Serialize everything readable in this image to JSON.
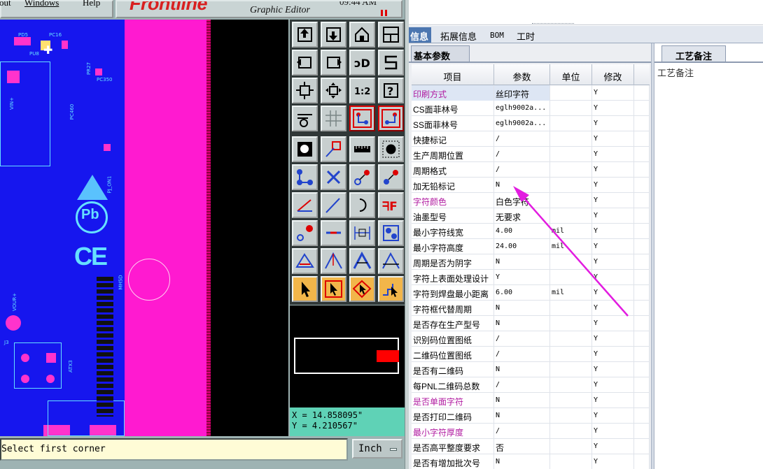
{
  "cad": {
    "menu": {
      "item_a": "out",
      "windows": "Windows",
      "help": "Help"
    },
    "logo": {
      "brand": "Frontline",
      "subtitle": "Graphic Editor",
      "time": "09:44 AM"
    },
    "board_labels": {
      "pc16": "PC16",
      "pu8": "PU8",
      "pd5": "PD5",
      "pr27": "PR27",
      "pc350": "PC350",
      "vin": "VIN+",
      "pc460": "PC460",
      "pj": "PJ_ON1",
      "mh": "MH5D",
      "vour": "VOUR+",
      "j3": "J3",
      "atx": "ATX3"
    },
    "coordinates": {
      "x": "X = 14.858095\"",
      "y": "Y = 4.210567\""
    },
    "prompt": "Select first corner",
    "units": "Inch",
    "tool_icons": [
      "move-up-icon",
      "move-down-icon",
      "home-icon",
      "window-icon",
      "align-left-icon",
      "align-right-icon",
      "undo-icon",
      "reshape-icon",
      "fit-icon",
      "zoom-icon",
      "ratio-icon",
      "help-icon",
      "settings-icon",
      "grid-icon",
      "layer-a-icon",
      "layer-b-icon",
      "pad-icon",
      "line-pad-icon",
      "measure-icon",
      "hole-icon",
      "net-icon",
      "cross-icon",
      "connect-icon",
      "route-icon",
      "draw-line-icon",
      "diag-line-icon",
      "arc-icon",
      "text-icon",
      "via-icon",
      "segment-icon",
      "dimension-icon",
      "component-icon",
      "triangle-a-icon",
      "triangle-b-icon",
      "triangle-c-icon",
      "triangle-d-icon",
      "select-icon",
      "select-box-icon",
      "select-net-icon",
      "select-path-icon"
    ],
    "ratio_label": "1:2"
  },
  "app": {
    "tabs": [
      "信息",
      "拓展信息",
      "BOM",
      "工时"
    ],
    "active_tab": "信息",
    "subtab": "基本参数",
    "columns": [
      "项目",
      "参数",
      "单位",
      "修改"
    ],
    "rows": [
      {
        "item": "印刷方式",
        "value": "丝印字符",
        "unit": "",
        "mod": "Y",
        "hl": true,
        "mono": false,
        "sel": true
      },
      {
        "item": "CS面菲林号",
        "value": "eglh9002a...",
        "unit": "",
        "mod": "Y",
        "hl": false,
        "mono": true
      },
      {
        "item": "SS面菲林号",
        "value": "eglh9002a...",
        "unit": "",
        "mod": "Y",
        "hl": false,
        "mono": true
      },
      {
        "item": "快捷标记",
        "value": "/",
        "unit": "",
        "mod": "Y",
        "hl": false,
        "mono": true
      },
      {
        "item": "生产周期位置",
        "value": "/",
        "unit": "",
        "mod": "Y",
        "hl": false,
        "mono": true
      },
      {
        "item": "周期格式",
        "value": "/",
        "unit": "",
        "mod": "Y",
        "hl": false,
        "mono": true
      },
      {
        "item": "加无铅标记",
        "value": "N",
        "unit": "",
        "mod": "Y",
        "hl": false,
        "mono": true
      },
      {
        "item": "字符颜色",
        "value": "白色字符",
        "unit": "",
        "mod": "Y",
        "hl": true,
        "mono": false
      },
      {
        "item": "油墨型号",
        "value": "无要求",
        "unit": "",
        "mod": "Y",
        "hl": false,
        "mono": false
      },
      {
        "item": "最小字符线宽",
        "value": "4.00",
        "unit": "mil",
        "mod": "Y",
        "hl": false,
        "mono": true
      },
      {
        "item": "最小字符高度",
        "value": "24.00",
        "unit": "mil",
        "mod": "Y",
        "hl": false,
        "mono": true
      },
      {
        "item": "周期是否为阴字",
        "value": "N",
        "unit": "",
        "mod": "Y",
        "hl": false,
        "mono": true
      },
      {
        "item": "字符上表面处理设计",
        "value": "Y",
        "unit": "",
        "mod": "Y",
        "hl": false,
        "mono": true
      },
      {
        "item": "字符到焊盘最小距离",
        "value": "6.00",
        "unit": "mil",
        "mod": "Y",
        "hl": false,
        "mono": true
      },
      {
        "item": "字符框代替周期",
        "value": "N",
        "unit": "",
        "mod": "Y",
        "hl": false,
        "mono": true
      },
      {
        "item": "是否存在生产型号",
        "value": "N",
        "unit": "",
        "mod": "Y",
        "hl": false,
        "mono": true
      },
      {
        "item": "识别码位置图纸",
        "value": "/",
        "unit": "",
        "mod": "Y",
        "hl": false,
        "mono": true
      },
      {
        "item": "二维码位置图纸",
        "value": "/",
        "unit": "",
        "mod": "Y",
        "hl": false,
        "mono": true
      },
      {
        "item": "是否有二维码",
        "value": "N",
        "unit": "",
        "mod": "Y",
        "hl": false,
        "mono": true
      },
      {
        "item": "每PNL二维码总数",
        "value": "/",
        "unit": "",
        "mod": "Y",
        "hl": false,
        "mono": true
      },
      {
        "item": "是否单面字符",
        "value": "N",
        "unit": "",
        "mod": "Y",
        "hl": true,
        "mono": true
      },
      {
        "item": "是否打印二维码",
        "value": "N",
        "unit": "",
        "mod": "Y",
        "hl": false,
        "mono": true
      },
      {
        "item": "最小字符厚度",
        "value": "/",
        "unit": "",
        "mod": "Y",
        "hl": true,
        "mono": true
      },
      {
        "item": "是否高平整度要求",
        "value": "否",
        "unit": "",
        "mod": "Y",
        "hl": false,
        "mono": false
      },
      {
        "item": "是否有增加批次号",
        "value": "N",
        "unit": "",
        "mod": "Y",
        "hl": false,
        "mono": true
      }
    ],
    "right_pane": {
      "tab": "工艺备注",
      "label": "工艺备注"
    },
    "colors": {
      "highlight_text": "#b01aa0",
      "annotation_arrow": "#e21ce0",
      "accent": "#4c76b0"
    }
  }
}
